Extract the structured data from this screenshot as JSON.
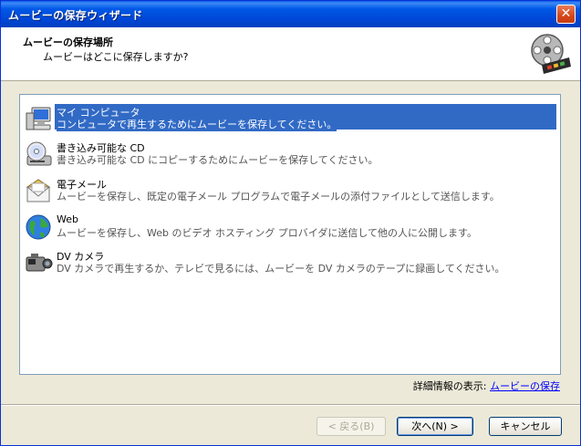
{
  "window": {
    "title": "ムービーの保存ウィザード",
    "close_symbol": "✕"
  },
  "header": {
    "title": "ムービーの保存場所",
    "subtitle": "ムービーはどこに保存しますか?",
    "icon": "film-reel-icon"
  },
  "options": [
    {
      "name": "マイ コンピュータ",
      "description": "コンピュータで再生するためにムービーを保存してください。",
      "icon": "my-computer-icon",
      "selected": true
    },
    {
      "name": "書き込み可能な CD",
      "description": "書き込み可能な CD にコピーするためにムービーを保存してください。",
      "icon": "cd-drive-icon",
      "selected": false
    },
    {
      "name": "電子メール",
      "description": "ムービーを保存し、既定の電子メール プログラムで電子メールの添付ファイルとして送信します。",
      "icon": "email-envelope-icon",
      "selected": false
    },
    {
      "name": "Web",
      "description": "ムービーを保存し、Web のビデオ ホスティング プロバイダに送信して他の人に公開します。",
      "icon": "globe-icon",
      "selected": false
    },
    {
      "name": "DV カメラ",
      "description": "DV カメラで再生するか、テレビで見るには、ムービーを DV カメラのテープに録画してください。",
      "icon": "dv-camera-icon",
      "selected": false
    }
  ],
  "details": {
    "label": "詳細情報の表示:",
    "link": "ムービーの保存"
  },
  "buttons": {
    "back": "< 戻る(B)",
    "next": "次へ(N) >",
    "cancel": "キャンセル"
  },
  "colors": {
    "selection": "#316ac5",
    "titlebar": "#0058e6",
    "dialog_bg": "#ece9d8"
  }
}
